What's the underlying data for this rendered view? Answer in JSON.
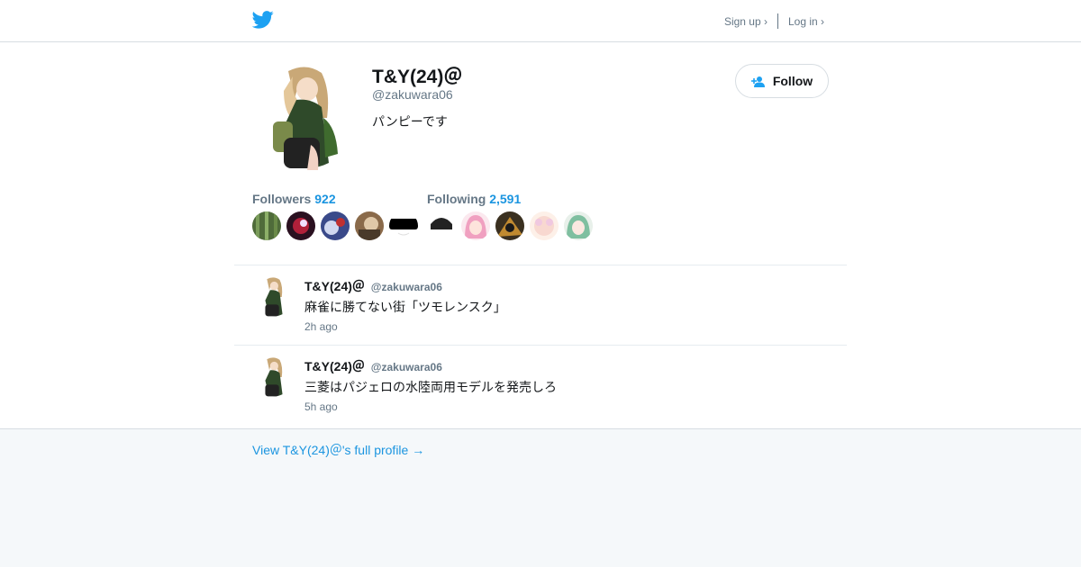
{
  "nav": {
    "logo_icon": "twitter-bird-icon",
    "signup_label": "Sign up ›",
    "login_label": "Log in ›"
  },
  "profile": {
    "name": "T&Y(24)＠",
    "handle": "@zakuwara06",
    "bio": "パンピーです",
    "follow_label": "Follow",
    "followers_label": "Followers",
    "followers_count": "922",
    "following_label": "Following",
    "following_count": "2,591"
  },
  "tweets": [
    {
      "name": "T&Y(24)＠",
      "handle": "@zakuwara06",
      "text": "麻雀に勝てない街「ツモレンスク」",
      "time": "2h ago"
    },
    {
      "name": "T&Y(24)＠",
      "handle": "@zakuwara06",
      "text": "三菱はパジェロの水陸両用モデルを発売しろ",
      "time": "5h ago"
    }
  ],
  "footer": {
    "view_profile_label": "View T&Y(24)＠'s full profile →"
  },
  "colors": {
    "accent": "#1b95e0",
    "twitter_blue": "#1da1f2",
    "muted": "#657786",
    "border": "#e6ecf0",
    "page_bg": "#f5f8fa"
  }
}
